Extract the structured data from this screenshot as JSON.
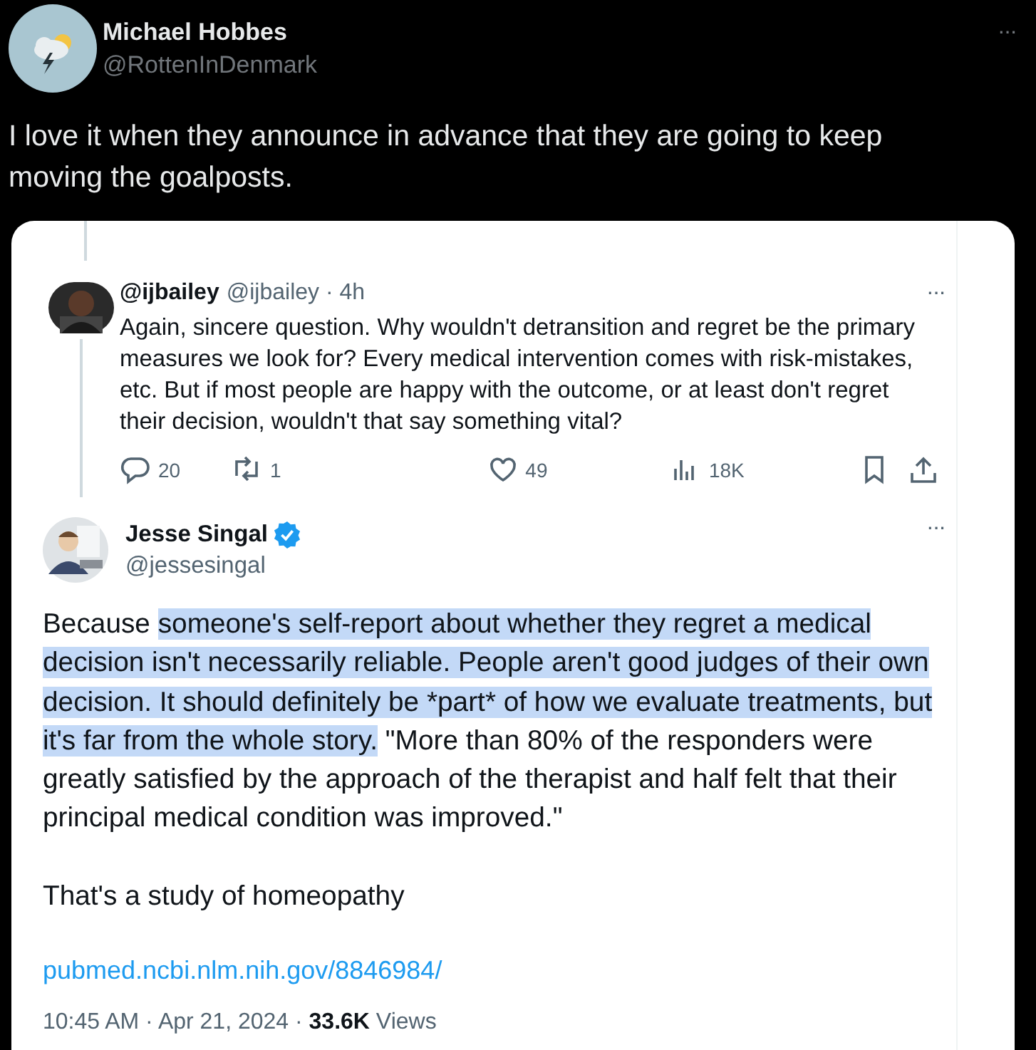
{
  "post": {
    "author": {
      "name": "Michael Hobbes",
      "handle": "@RottenInDenmark"
    },
    "more": "···",
    "text": "I love it when they announce in advance that they are going to keep moving the goalposts.",
    "screenshot": {
      "reply": {
        "name": "@ijbailey",
        "meta": "@ijbailey · 4h",
        "more": "···",
        "text": "Again, sincere question. Why wouldn't detransition and regret be the primary measures we look for? Every medical intervention comes with risk-mistakes, etc. But if most people are happy with the outcome, or at least don't regret their decision, wouldn't that say something vital?",
        "actions": [
          {
            "kind": "reply",
            "count": "20"
          },
          {
            "kind": "repost",
            "count": "1"
          },
          {
            "kind": "like",
            "count": "49"
          },
          {
            "kind": "views",
            "count": "18K"
          },
          {
            "kind": "bookmark"
          },
          {
            "kind": "share"
          }
        ]
      },
      "tweet": {
        "name": "Jesse Singal",
        "verified": true,
        "handle": "@jessesingal",
        "more": "···",
        "paragraphs": [
          {
            "segments": [
              {
                "text": "Because ",
                "highlighted": false
              },
              {
                "text": "someone's self-report about whether they regret a medical decision isn't necessarily reliable. People aren't good judges of their own decision. It should definitely be *part* of how we evaluate treatments, but it's far from the whole story.",
                "highlighted": true
              },
              {
                "text": " \"More than 80% of the responders were greatly satisfied by the approach of the therapist and half felt that their principal medical condition was improved.\"",
                "highlighted": false
              }
            ]
          },
          {
            "segments": [
              {
                "text": "That's a study of homeopathy",
                "highlighted": false
              }
            ]
          }
        ],
        "link": "pubmed.ncbi.nlm.nih.gov/8846984/",
        "footer": "10:45 AM · Apr 21, 2024 · **33.6K** Views"
      }
    }
  }
}
